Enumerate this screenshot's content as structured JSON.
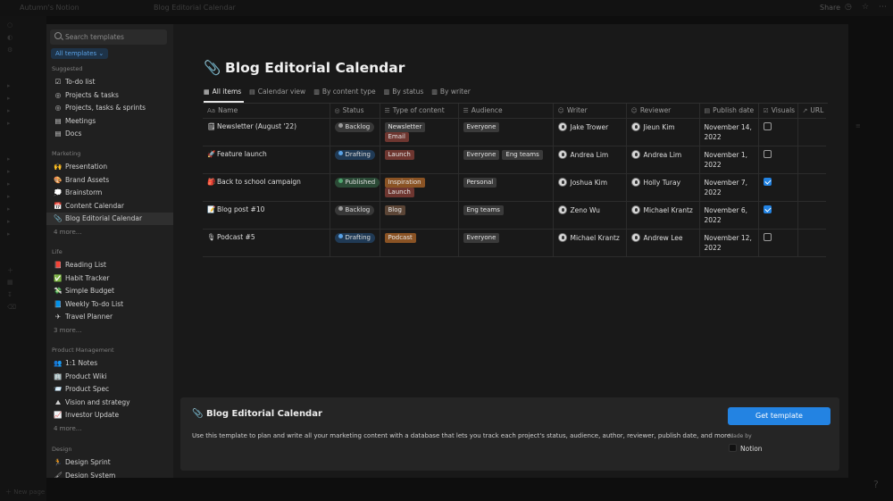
{
  "colors": {
    "accent": "#2383e2",
    "tag_gray": "#3a3a3a",
    "tag_orange": "#8a5324",
    "tag_red": "#6e3630",
    "tag_brown": "#5b4536",
    "status_gray_bg": "#383838",
    "status_gray_dot": "#9b9b9b",
    "status_blue_bg": "#203a55",
    "status_blue_dot": "#5aa2e6",
    "status_green_bg": "#2b4a36",
    "status_green_dot": "#4fa66f"
  },
  "background": {
    "workspace": "Autumn's Notion",
    "breadcrumb": "Blog Editorial Calendar",
    "share": "Share",
    "new_page": "New page"
  },
  "sidebar": {
    "search_placeholder": "Search templates",
    "filter": "All templates ⌄",
    "sections": [
      {
        "title": "Suggested",
        "items": [
          {
            "icon": "☑",
            "icon_name": "checkbox-icon",
            "label": "To-do list"
          },
          {
            "icon": "◎",
            "icon_name": "target-icon",
            "label": "Projects & tasks"
          },
          {
            "icon": "◎",
            "icon_name": "target-icon",
            "label": "Projects, tasks & sprints"
          },
          {
            "icon": "▤",
            "icon_name": "calendar-icon",
            "label": "Meetings"
          },
          {
            "icon": "▤",
            "icon_name": "document-icon",
            "label": "Docs"
          }
        ],
        "more": ""
      },
      {
        "title": "Marketing",
        "items": [
          {
            "icon": "🙌",
            "icon_name": "raised-hands-icon",
            "label": "Presentation"
          },
          {
            "icon": "🎨",
            "icon_name": "palette-icon",
            "label": "Brand Assets"
          },
          {
            "icon": "💭",
            "icon_name": "thought-bubble-icon",
            "label": "Brainstorm"
          },
          {
            "icon": "📅",
            "icon_name": "calendar-icon",
            "label": "Content Calendar"
          },
          {
            "icon": "📎",
            "icon_name": "pen-icon",
            "label": "Blog Editorial Calendar",
            "active": true
          }
        ],
        "more": "4 more..."
      },
      {
        "title": "Life",
        "items": [
          {
            "icon": "📕",
            "icon_name": "book-icon",
            "label": "Reading List"
          },
          {
            "icon": "✅",
            "icon_name": "check-icon",
            "label": "Habit Tracker"
          },
          {
            "icon": "💸",
            "icon_name": "money-icon",
            "label": "Simple Budget"
          },
          {
            "icon": "📘",
            "icon_name": "notebook-icon",
            "label": "Weekly To-do List"
          },
          {
            "icon": "✈",
            "icon_name": "airplane-icon",
            "label": "Travel Planner"
          }
        ],
        "more": "3 more..."
      },
      {
        "title": "Product Management",
        "items": [
          {
            "icon": "👥",
            "icon_name": "people-icon",
            "label": "1:1 Notes"
          },
          {
            "icon": "🏢",
            "icon_name": "building-icon",
            "label": "Product Wiki"
          },
          {
            "icon": "📨",
            "icon_name": "envelope-icon",
            "label": "Product Spec"
          },
          {
            "icon": "⛰",
            "icon_name": "mountain-icon",
            "label": "Vision and strategy"
          },
          {
            "icon": "📈",
            "icon_name": "chart-icon",
            "label": "Investor Update"
          }
        ],
        "more": "4 more..."
      },
      {
        "title": "Design",
        "items": [
          {
            "icon": "🏃",
            "icon_name": "runner-icon",
            "label": "Design Sprint"
          },
          {
            "icon": "🖌",
            "icon_name": "brush-icon",
            "label": "Design System"
          }
        ],
        "more": ""
      }
    ]
  },
  "preview": {
    "title": "Blog Editorial Calendar",
    "title_icon": "📎",
    "views": [
      {
        "icon": "▦",
        "label": "All items",
        "active": true
      },
      {
        "icon": "▤",
        "label": "Calendar view"
      },
      {
        "icon": "▥",
        "label": "By content type"
      },
      {
        "icon": "▥",
        "label": "By status"
      },
      {
        "icon": "▥",
        "label": "By writer"
      }
    ],
    "columns": [
      {
        "icon": "Aa",
        "label": "Name"
      },
      {
        "icon": "◎",
        "label": "Status"
      },
      {
        "icon": "☰",
        "label": "Type of content"
      },
      {
        "icon": "☰",
        "label": "Audience"
      },
      {
        "icon": "☺",
        "label": "Writer"
      },
      {
        "icon": "☺",
        "label": "Reviewer"
      },
      {
        "icon": "▤",
        "label": "Publish date"
      },
      {
        "icon": "☑",
        "label": "Visuals"
      },
      {
        "icon": "↗",
        "label": "URL"
      }
    ],
    "rows": [
      {
        "icon": "🗒",
        "name": "Newsletter (August '22)",
        "status": "Backlog",
        "status_color": "gray",
        "types": [
          {
            "label": "Newsletter",
            "color": "gray"
          },
          {
            "label": "Email",
            "color": "red"
          }
        ],
        "audience": [
          {
            "label": "Everyone",
            "color": "gray"
          }
        ],
        "writer": "Jake Trower",
        "reviewer": "Jieun Kim",
        "date": "November 14, 2022",
        "visuals": false
      },
      {
        "icon": "🚀",
        "name": "Feature launch",
        "status": "Drafting",
        "status_color": "blue",
        "types": [
          {
            "label": "Launch",
            "color": "red"
          }
        ],
        "audience": [
          {
            "label": "Everyone",
            "color": "gray"
          },
          {
            "label": "Eng teams",
            "color": "gray"
          }
        ],
        "writer": "Andrea Lim",
        "reviewer": "Andrea Lim",
        "date": "November 1, 2022",
        "visuals": false
      },
      {
        "icon": "🎒",
        "name": "Back to school campaign",
        "status": "Published",
        "status_color": "green",
        "types": [
          {
            "label": "Inspiration",
            "color": "orange"
          },
          {
            "label": "Launch",
            "color": "red"
          }
        ],
        "audience": [
          {
            "label": "Personal",
            "color": "gray"
          }
        ],
        "writer": "Joshua Kim",
        "reviewer": "Holly Turay",
        "date": "November 7, 2022",
        "visuals": true
      },
      {
        "icon": "📝",
        "name": "Blog post #10",
        "status": "Backlog",
        "status_color": "gray",
        "types": [
          {
            "label": "Blog",
            "color": "brown"
          }
        ],
        "audience": [
          {
            "label": "Eng teams",
            "color": "gray"
          }
        ],
        "writer": "Zeno Wu",
        "reviewer": "Michael Krantz",
        "date": "November 6, 2022",
        "visuals": true
      },
      {
        "icon": "🎙",
        "name": "Podcast #5",
        "status": "Drafting",
        "status_color": "blue",
        "types": [
          {
            "label": "Podcast",
            "color": "orange"
          }
        ],
        "audience": [
          {
            "label": "Everyone",
            "color": "gray"
          }
        ],
        "writer": "Michael Krantz",
        "reviewer": "Andrew Lee",
        "date": "November 12, 2022",
        "visuals": false
      }
    ]
  },
  "footer": {
    "title_icon": "📎",
    "title": "Blog Editorial Calendar",
    "description": "Use this template to plan and write all your marketing content with a database that lets you track each project's status, audience, author, reviewer, publish date, and more.",
    "button": "Get template",
    "made_by_label": "Made by",
    "author": "Notion"
  }
}
